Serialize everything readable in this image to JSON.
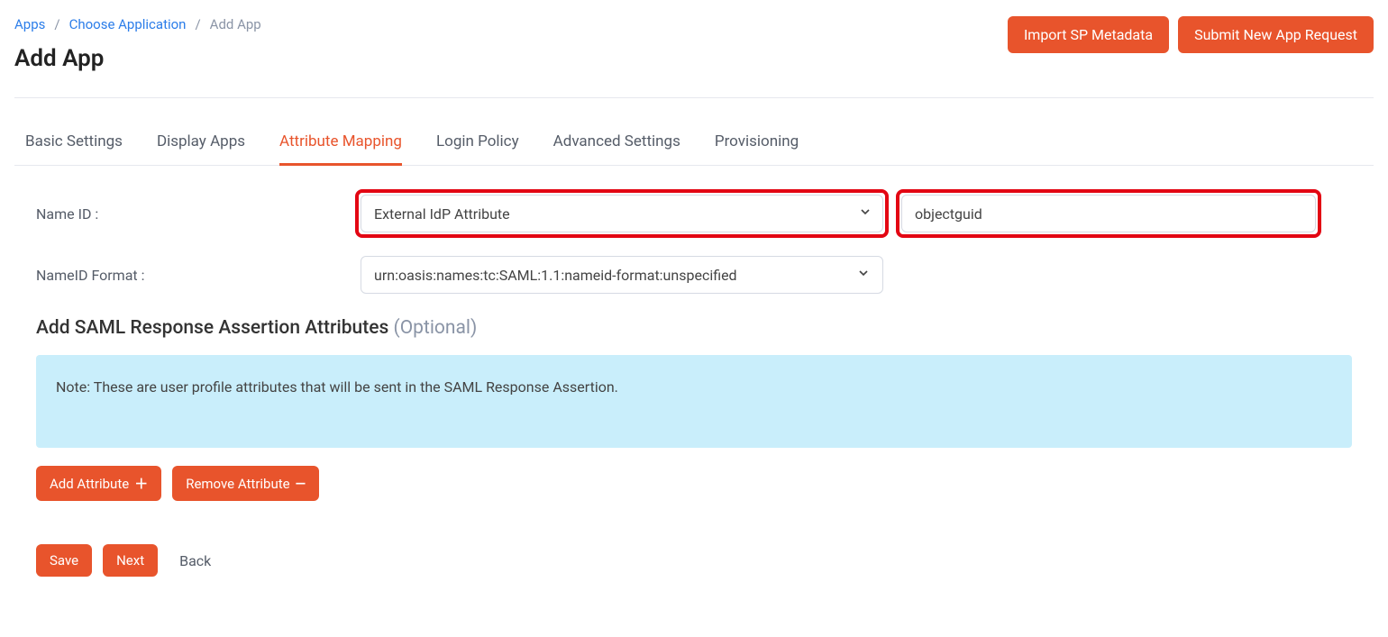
{
  "breadcrumb": {
    "items": [
      "Apps",
      "Choose Application"
    ],
    "current": "Add App"
  },
  "page_title": "Add App",
  "top_buttons": {
    "import": "Import SP Metadata",
    "submit": "Submit New App Request"
  },
  "tabs": [
    {
      "label": "Basic Settings",
      "active": false
    },
    {
      "label": "Display Apps",
      "active": false
    },
    {
      "label": "Attribute Mapping",
      "active": true
    },
    {
      "label": "Login Policy",
      "active": false
    },
    {
      "label": "Advanced Settings",
      "active": false
    },
    {
      "label": "Provisioning",
      "active": false
    }
  ],
  "form": {
    "name_id_label": "Name ID :",
    "name_id_value": "External IdP Attribute",
    "name_id_text": "objectguid",
    "format_label": "NameID Format :",
    "format_value": "urn:oasis:names:tc:SAML:1.1:nameid-format:unspecified"
  },
  "section": {
    "title": "Add SAML Response Assertion Attributes",
    "optional": "(Optional)",
    "note": "Note: These are user profile attributes that will be sent in the SAML Response Assertion."
  },
  "attr_buttons": {
    "add": "Add Attribute",
    "remove": "Remove Attribute"
  },
  "bottom": {
    "save": "Save",
    "next": "Next",
    "back": "Back"
  },
  "highlight_color": "#e30613"
}
